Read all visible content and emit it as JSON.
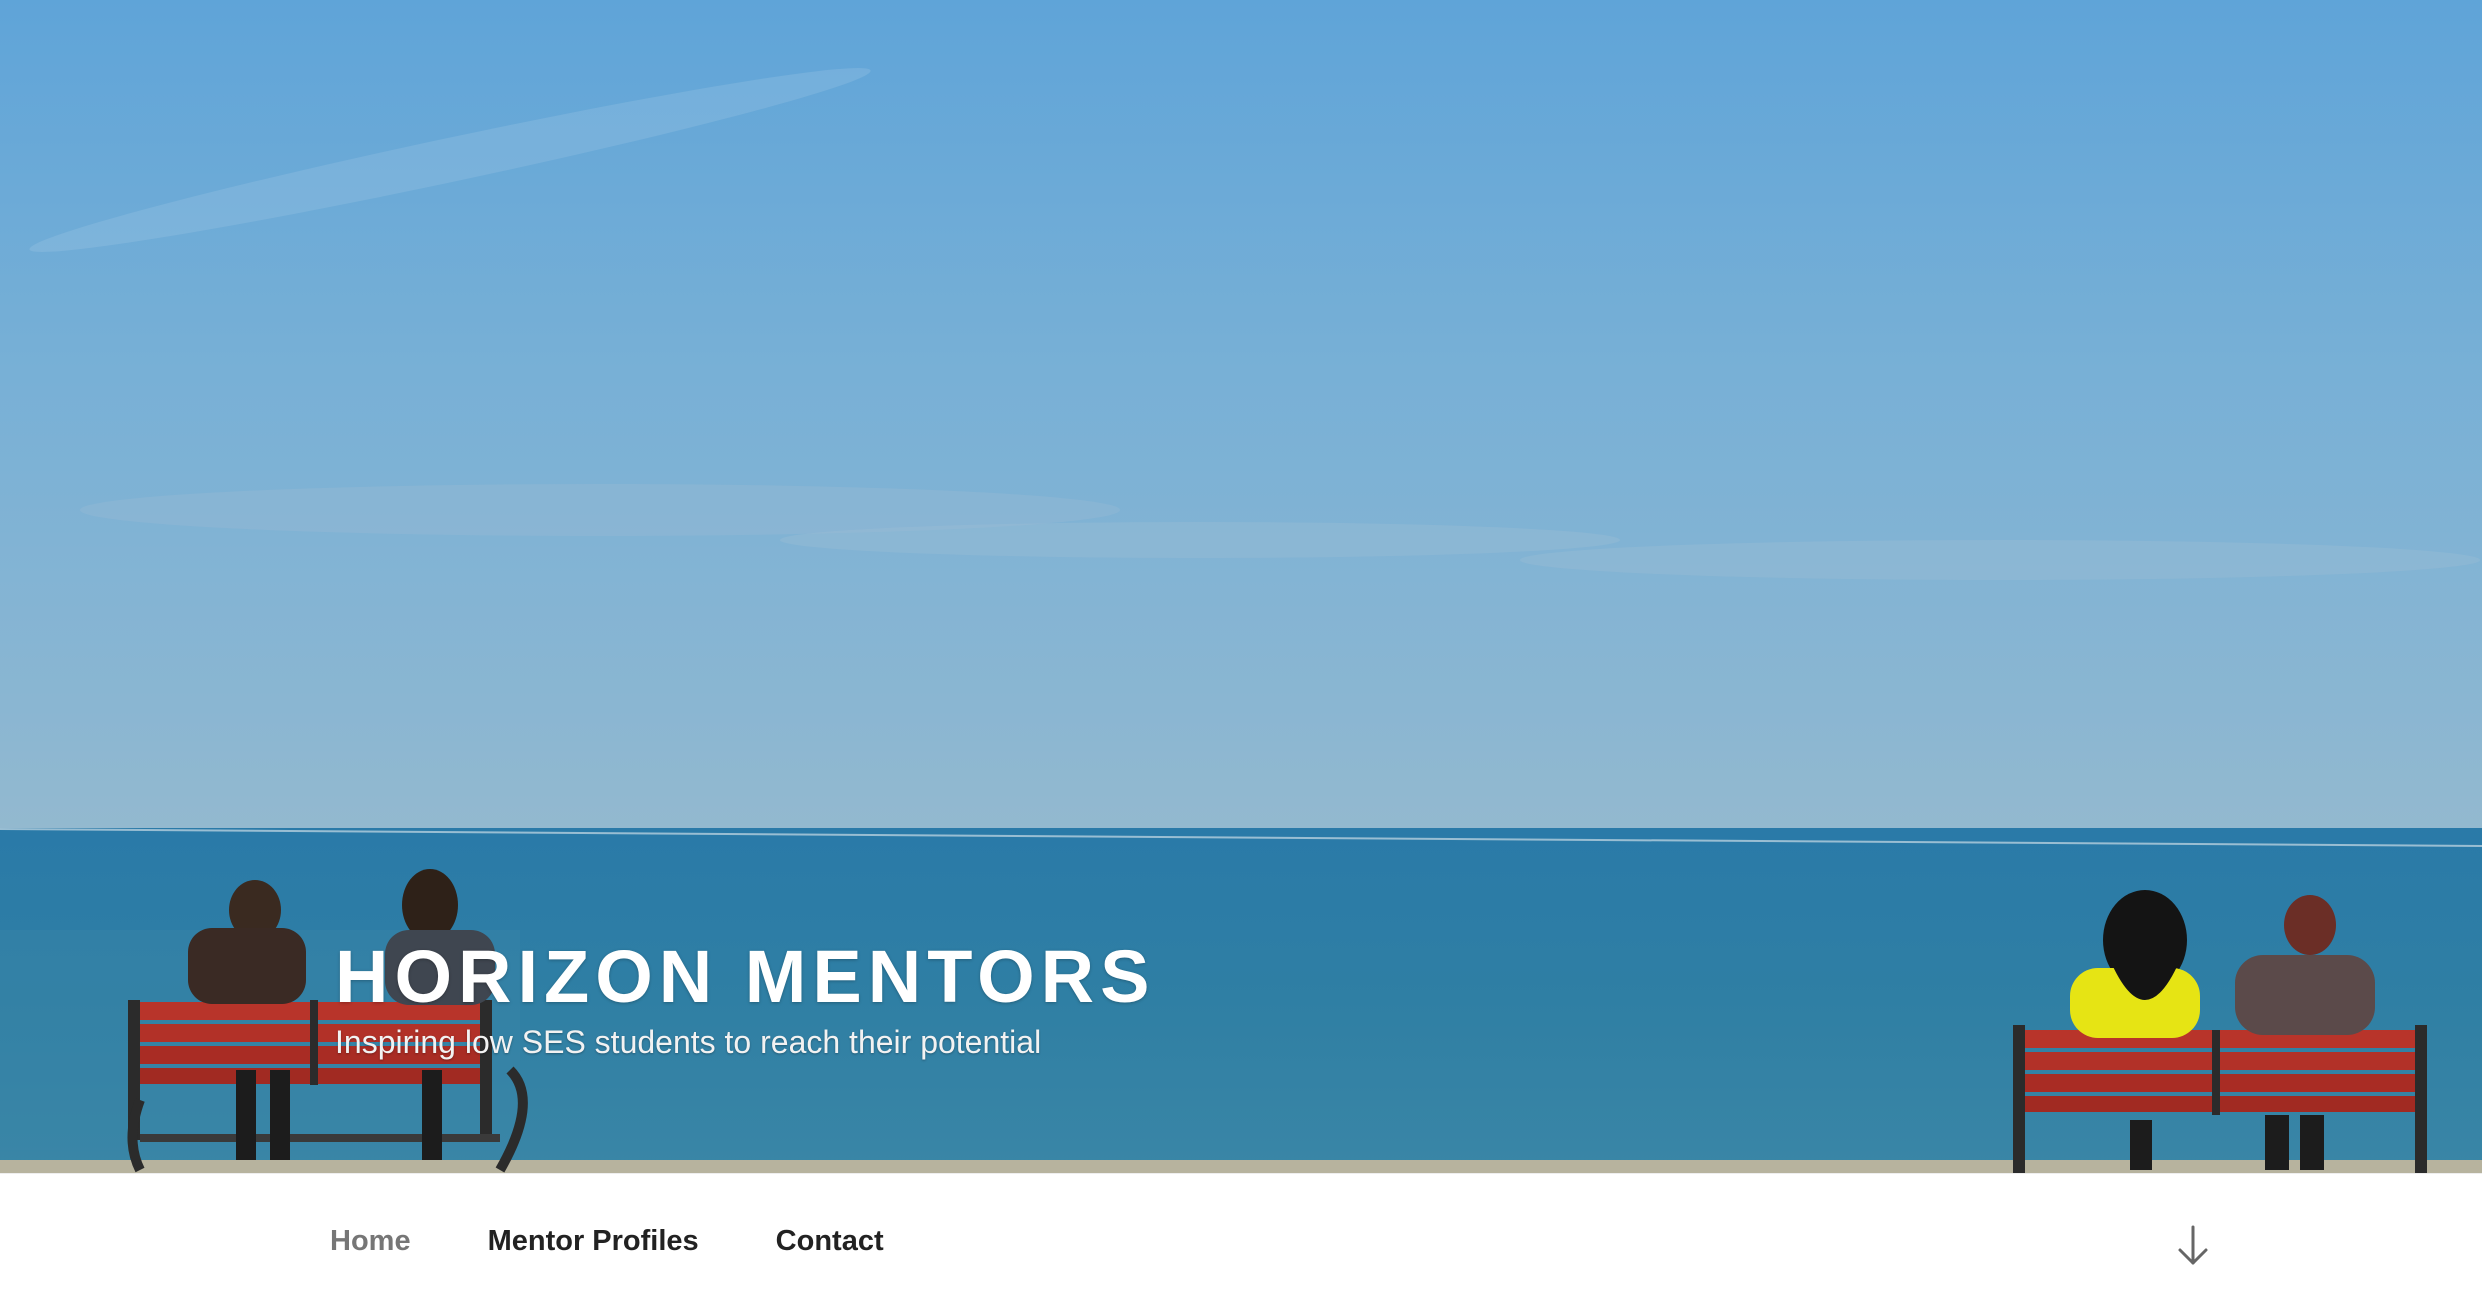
{
  "header": {
    "site_title": "HORIZON MENTORS",
    "site_description": "Inspiring low SES students to reach their potential"
  },
  "navigation": {
    "items": [
      {
        "label": "Home",
        "current": true
      },
      {
        "label": "Mentor Profiles",
        "current": false
      },
      {
        "label": "Contact",
        "current": false
      }
    ],
    "scroll_icon": "arrow-down-icon"
  },
  "colors": {
    "sky_top": "#5fa4d8",
    "sea": "#2f7fa4",
    "bench_red": "#b8342a",
    "nav_text": "#222222",
    "nav_current": "#767676"
  }
}
